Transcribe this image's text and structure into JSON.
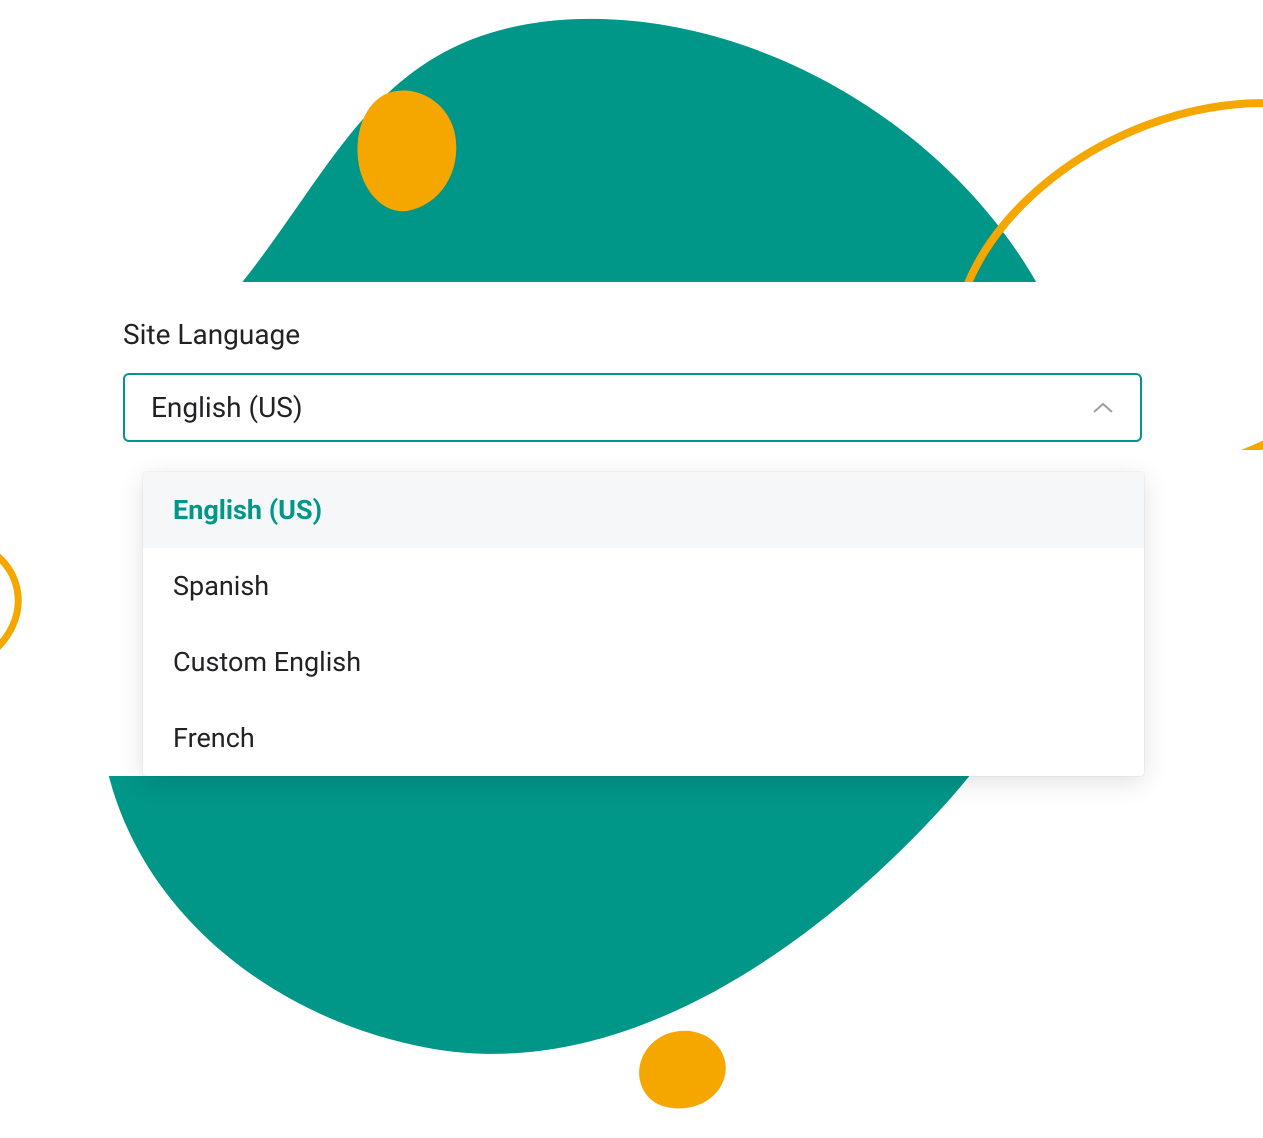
{
  "colors": {
    "accent": "#009688",
    "orange": "#f5a700"
  },
  "field": {
    "label": "Site Language",
    "selected": "English (US)"
  },
  "options": [
    {
      "label": "English (US)",
      "selected": true
    },
    {
      "label": "Spanish",
      "selected": false
    },
    {
      "label": "Custom English",
      "selected": false
    },
    {
      "label": "French",
      "selected": false
    }
  ]
}
